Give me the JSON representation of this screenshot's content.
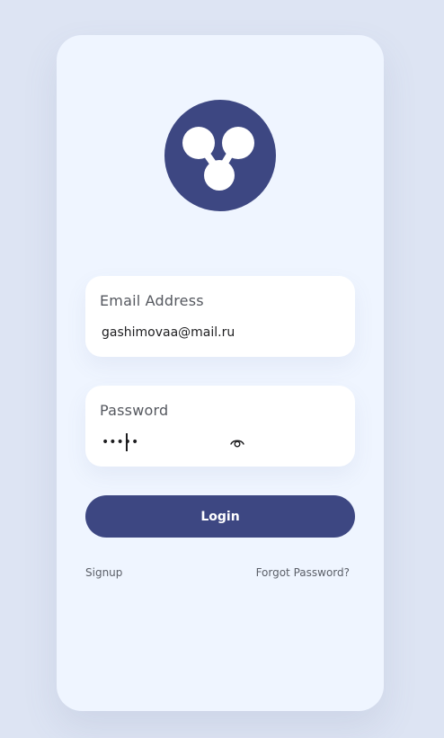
{
  "login_form": {
    "email_label": "Email Address",
    "email_value": "gashimovaa@mail.ru",
    "password_label": "Password",
    "password_value": "•••••",
    "login_label": "Login",
    "signup_label": "Signup",
    "forgot_label": "Forgot Password?"
  },
  "icons": {
    "logo": "logo-icon",
    "password_toggle": "eye-icon"
  },
  "colors": {
    "page_background": "#dde4f3",
    "card_background": "#eff5ff",
    "accent": "#3d4782",
    "field_background": "#ffffff"
  }
}
